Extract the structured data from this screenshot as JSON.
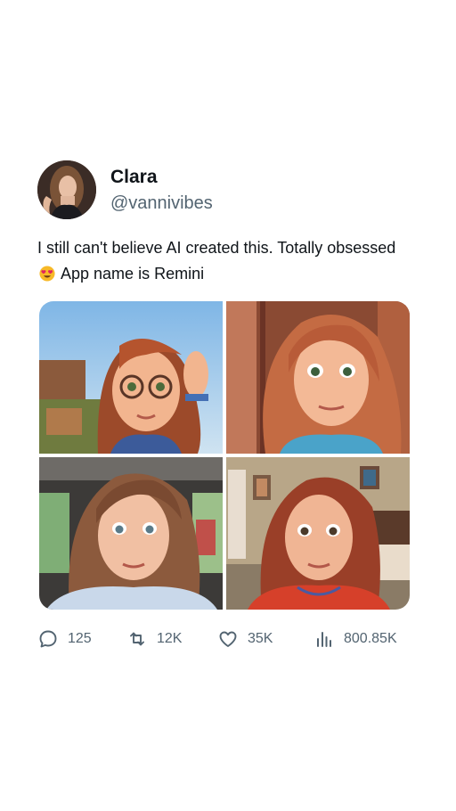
{
  "tweet": {
    "author_name": "Clara",
    "author_handle": "@vannivibes",
    "text_before_emoji": "I still can't believe AI created this. Totally obsessed ",
    "emoji": "smiling-face-with-heart-eyes",
    "text_after_emoji": " App name is Remini",
    "media": [
      {
        "description_icon": "cartoon-portrait-glasses"
      },
      {
        "description_icon": "cartoon-portrait-long-hair"
      },
      {
        "description_icon": "cartoon-portrait-car"
      },
      {
        "description_icon": "cartoon-portrait-living-room"
      }
    ],
    "stats": {
      "replies": "125",
      "retweets": "12K",
      "likes": "35K",
      "views": "800.85K"
    }
  },
  "colors": {
    "text": "#0f1419",
    "secondary": "#536471",
    "background": "#ffffff"
  }
}
